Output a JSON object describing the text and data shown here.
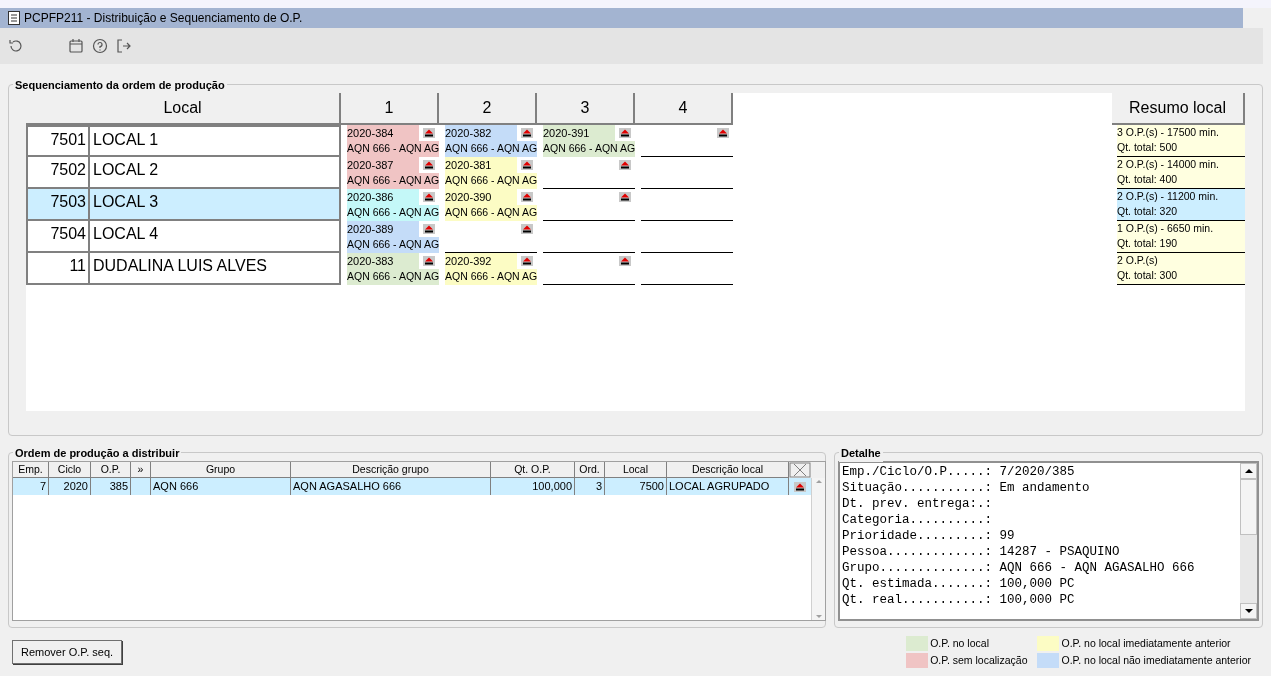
{
  "window": {
    "title": "PCPFP211 - Distribuição e Sequenciamento de O.P."
  },
  "sequencing": {
    "title": "Sequenciamento da ordem de produção",
    "local_header": "Local",
    "slot_headers": [
      "1",
      "2",
      "3",
      "4"
    ],
    "summary_header": "Resumo local",
    "rows": [
      {
        "code": "7501",
        "name": "LOCAL 1",
        "selected": false,
        "summary": [
          "3 O.P.(s) - 17500 min.",
          "Qt. total: 500"
        ],
        "cells": [
          {
            "kind": "op",
            "code": "2020-384",
            "desc": "AQN 666 - AQN AG",
            "color": "#f0c4c4"
          },
          {
            "kind": "op",
            "code": "2020-382",
            "desc": "AQN 666 - AQN AG",
            "color": "#c4dcf8"
          },
          {
            "kind": "op",
            "code": "2020-391",
            "desc": "AQN 666 - AQN AG",
            "color": "#dcebd0"
          },
          {
            "kind": "slot"
          }
        ]
      },
      {
        "code": "7502",
        "name": "LOCAL 2",
        "selected": false,
        "summary": [
          "2 O.P.(s) - 14000 min.",
          "Qt. total: 400"
        ],
        "cells": [
          {
            "kind": "op",
            "code": "2020-387",
            "desc": "AQN 666 - AQN AG",
            "color": "#f0c4c4"
          },
          {
            "kind": "op",
            "code": "2020-381",
            "desc": "AQN 666 - AQN AG",
            "color": "#fcfcc4"
          },
          {
            "kind": "slot"
          },
          {
            "kind": "blank"
          }
        ]
      },
      {
        "code": "7503",
        "name": "LOCAL 3",
        "selected": true,
        "summary": [
          "2 O.P.(s) - 11200 min.",
          "Qt. total: 320"
        ],
        "cells": [
          {
            "kind": "op",
            "code": "2020-386",
            "desc": "AQN 666 - AQN AG",
            "color": "#c4f8f8"
          },
          {
            "kind": "op",
            "code": "2020-390",
            "desc": "AQN 666 - AQN AG",
            "color": "#fcfcc4"
          },
          {
            "kind": "slot"
          },
          {
            "kind": "blank"
          }
        ]
      },
      {
        "code": "7504",
        "name": "LOCAL 4",
        "selected": false,
        "summary": [
          "1 O.P.(s) - 6650 min.",
          "Qt. total: 190"
        ],
        "cells": [
          {
            "kind": "op",
            "code": "2020-389",
            "desc": "AQN 666 - AQN AG",
            "color": "#c4dcf8"
          },
          {
            "kind": "slot"
          },
          {
            "kind": "blank"
          },
          {
            "kind": "blank"
          }
        ]
      },
      {
        "code": "11",
        "name": "DUDALINA LUIS ALVES",
        "selected": false,
        "summary": [
          "2 O.P.(s)",
          "Qt. total: 300"
        ],
        "cells": [
          {
            "kind": "op",
            "code": "2020-383",
            "desc": "AQN 666 - AQN AG",
            "color": "#dcebd0"
          },
          {
            "kind": "op",
            "code": "2020-392",
            "desc": "AQN 666 - AQN AG",
            "color": "#fcfcc4"
          },
          {
            "kind": "slot"
          },
          {
            "kind": "blank"
          }
        ]
      }
    ]
  },
  "orders": {
    "title": "Ordem de produção a distribuir",
    "columns": [
      "Emp.",
      "Ciclo",
      "O.P.",
      "»",
      "Grupo",
      "Descrição grupo",
      "Qt. O.P.",
      "Ord.",
      "Local",
      "Descrição local"
    ],
    "rows": [
      {
        "selected": true,
        "cells": [
          "7",
          "2020",
          "385",
          "",
          "AQN 666",
          "AQN AGASALHO 666",
          "100,000",
          "3",
          "7500",
          "LOCAL AGRUPADO"
        ]
      }
    ]
  },
  "detail": {
    "title": "Detalhe",
    "lines": [
      "Emp./Ciclo/O.P.....: 7/2020/385",
      "Situação...........: Em andamento",
      "Dt. prev. entrega:.:",
      "Categoria..........:",
      "Prioridade.........: 99",
      "Pessoa.............: 14287 - PSAQUINO",
      "Grupo..............: AQN 666 - AQN AGASALHO 666",
      "Qt. estimada.......: 100,000 PC",
      "Qt. real...........: 100,000 PC"
    ]
  },
  "remove_button": "Remover O.P. seq.",
  "legend": [
    {
      "label": "O.P. no local",
      "color": "#dcebd0"
    },
    {
      "label": "O.P. no local imediatamente anterior",
      "color": "#fcfcc4"
    },
    {
      "label": "O.P. sem localização",
      "color": "#f0c4c4"
    },
    {
      "label": "O.P. no local não imediatamente anterior",
      "color": "#c4dcf8"
    }
  ]
}
